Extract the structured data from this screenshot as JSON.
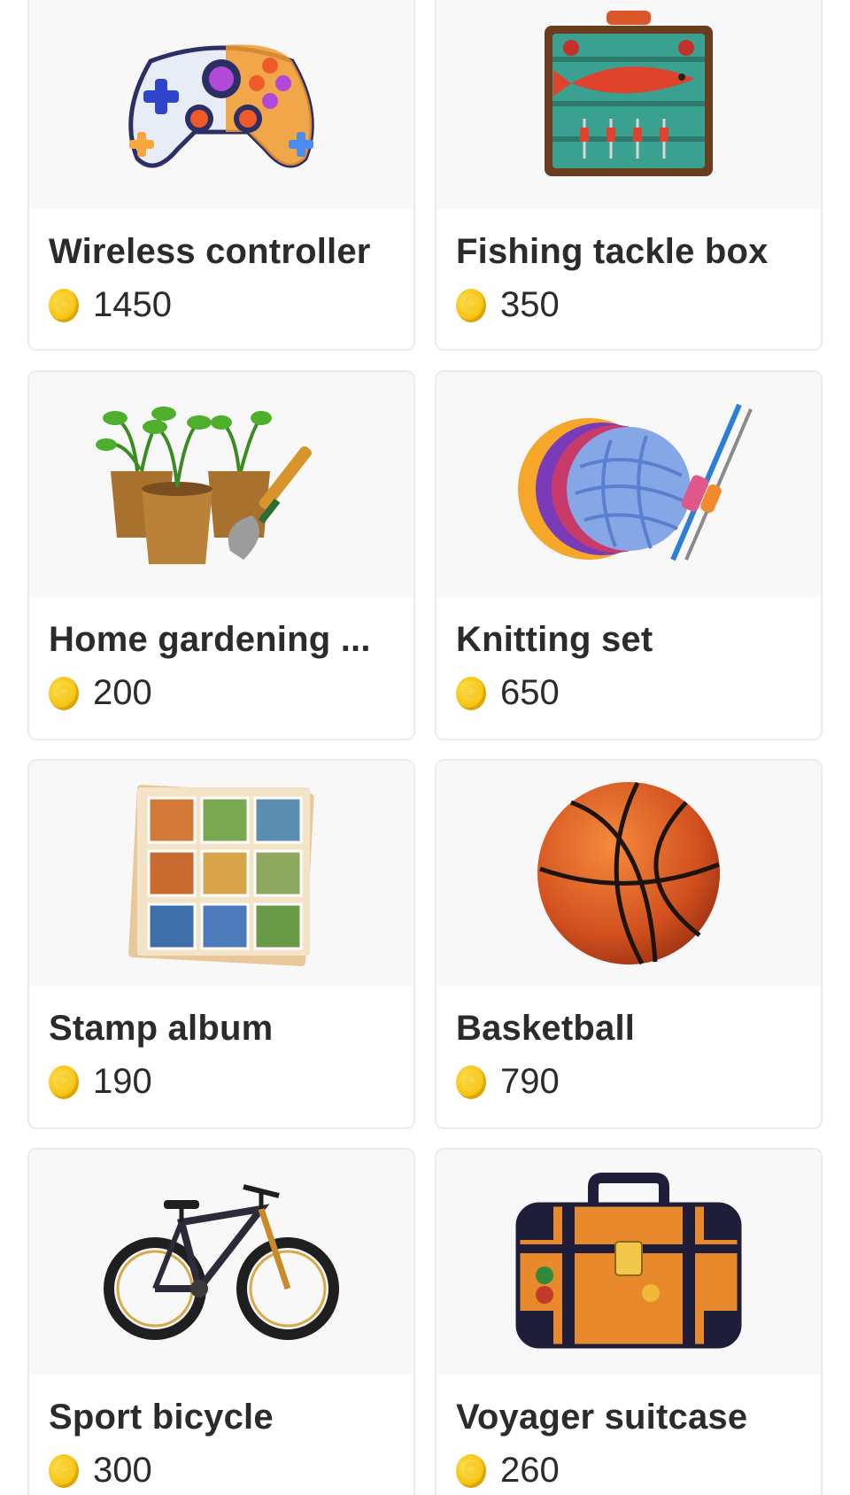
{
  "currency_icon": "coin-icon",
  "accent_color": "#f7c514",
  "products": [
    {
      "name": "Wireless controller",
      "price": "1450",
      "icon": "game-controller-icon"
    },
    {
      "name": "Fishing tackle box",
      "price": "350",
      "icon": "tackle-box-icon"
    },
    {
      "name": "Home gardening ...",
      "price": "200",
      "icon": "potted-plants-trowel-icon"
    },
    {
      "name": "Knitting set",
      "price": "650",
      "icon": "yarn-ball-needles-icon"
    },
    {
      "name": "Stamp album",
      "price": "190",
      "icon": "stamp-album-icon"
    },
    {
      "name": "Basketball",
      "price": "790",
      "icon": "basketball-icon"
    },
    {
      "name": "Sport bicycle",
      "price": "300",
      "icon": "bicycle-icon"
    },
    {
      "name": "Voyager suitcase",
      "price": "260",
      "icon": "suitcase-icon"
    }
  ]
}
